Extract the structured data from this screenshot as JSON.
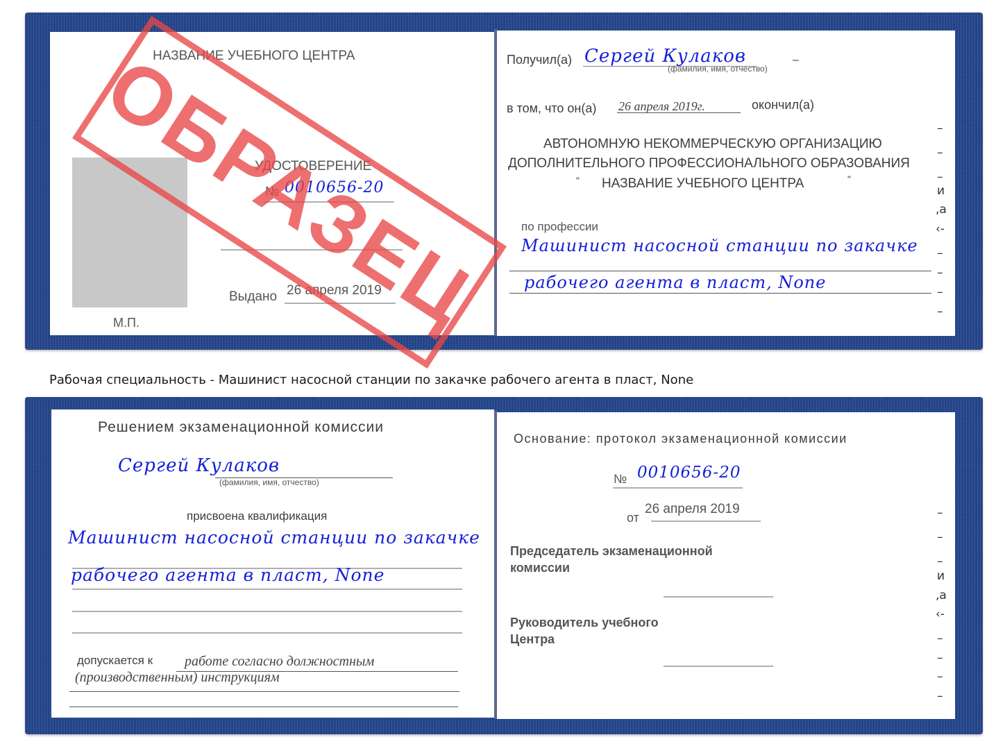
{
  "stamp": {
    "text": "ОБРАЗЕЦ",
    "color": "#e84646"
  },
  "colors": {
    "cover": "#25478f",
    "handwriting": "#1420d8",
    "print": "#555555"
  },
  "top_left": {
    "center_name": "НАЗВАНИЕ УЧЕБНОГО ЦЕНТРА",
    "doc_title": "УДОСТОВЕРЕНИЕ",
    "number_label": "№",
    "number_value": "0010656-20",
    "issued_label": "Выдано",
    "issued_date": "26 апреля 2019",
    "seal_label": "М.П."
  },
  "top_right": {
    "received_label": "Получил(а)",
    "recipient_name": "Сергей Кулаков",
    "fio_hint": "(фамилия, имя, отчество)",
    "that_label": "в том, что он(а)",
    "completion_date": "26 апреля 2019г.",
    "completed_label": "окончил(а)",
    "org_line1": "АВТОНОМНУЮ НЕКОММЕРЧЕСКУЮ ОРГАНИЗАЦИЮ",
    "org_line2": "ДОПОЛНИТЕЛЬНОГО ПРОФЕССИОНАЛЬНОГО ОБРАЗОВАНИЯ",
    "org_line3_open_quote": "\"",
    "org_line3": "НАЗВАНИЕ УЧЕБНОГО ЦЕНТРА",
    "org_line3_close_quote": "\"",
    "profession_label": "по профессии",
    "profession_line1": "Машинист насосной станции по закачке",
    "profession_line2": "рабочего агента в пласт, None"
  },
  "caption": {
    "text": "Рабочая специальность - Машинист насосной станции по закачке рабочего агента в пласт, None"
  },
  "bottom_left": {
    "heading": "Решением экзаменационной комиссии",
    "recipient_name": "Сергей Кулаков",
    "fio_hint": "(фамилия, имя, отчество)",
    "qualification_label": "присвоена квалификация",
    "qualification_line1": "Машинист насосной станции по закачке",
    "qualification_line2": "рабочего агента в пласт, None",
    "admitted_label": "допускается к",
    "admitted_line1": "работе согласно должностным",
    "admitted_line2": "(производственным) инструкциям"
  },
  "bottom_right": {
    "basis_heading": "Основание: протокол экзаменационной комиссии",
    "number_label": "№",
    "number_value": "0010656-20",
    "date_label": "от",
    "date_value": "26 апреля 2019",
    "chairman_line1": "Председатель экзаменационной",
    "chairman_line2": "комиссии",
    "head_line1": "Руководитель учебного",
    "head_line2": "Центра"
  },
  "edge_marks": [
    "–",
    "–",
    "–",
    "и",
    ",а",
    "‹-",
    "–",
    "–",
    "–",
    "–"
  ]
}
